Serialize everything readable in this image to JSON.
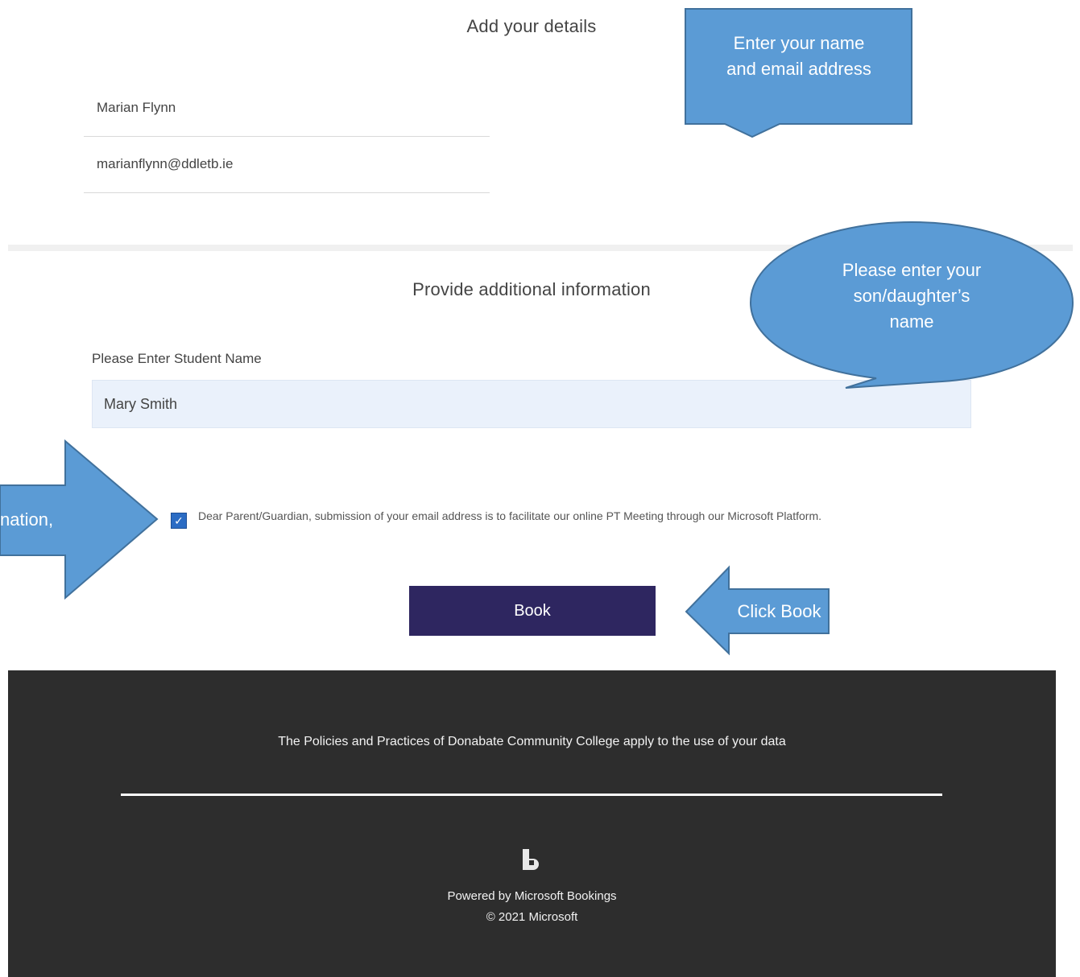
{
  "details": {
    "title": "Add your details",
    "name_value": "Marian Flynn",
    "email_value": "marianflynn@ddletb.ie"
  },
  "additional": {
    "title": "Provide additional information",
    "student_label": "Please Enter Student Name",
    "student_value": "Mary Smith"
  },
  "consent": {
    "checked": true,
    "text": "Dear Parent/Guardian, submission of your email address is to facilitate our online PT Meeting through our Microsoft Platform."
  },
  "book_button": {
    "label": "Book"
  },
  "footer": {
    "policy": "The Policies and Practices of Donabate Community College apply to the use of your data",
    "powered": "Powered by Microsoft Bookings",
    "copyright": "© 2021 Microsoft"
  },
  "callouts": {
    "email": {
      "line1": "Enter your name",
      "line2": "and email address"
    },
    "student": {
      "line1": "Please enter your",
      "line2": "son/daughter’s",
      "line3": "name"
    },
    "left_arrow": "nation,",
    "book": "Click Book"
  },
  "colors": {
    "callout_fill": "#5b9bd5",
    "callout_stroke": "#41719c",
    "button": "#2e2660",
    "footer": "#2d2d2d",
    "input_fill": "#eaf1fb"
  }
}
